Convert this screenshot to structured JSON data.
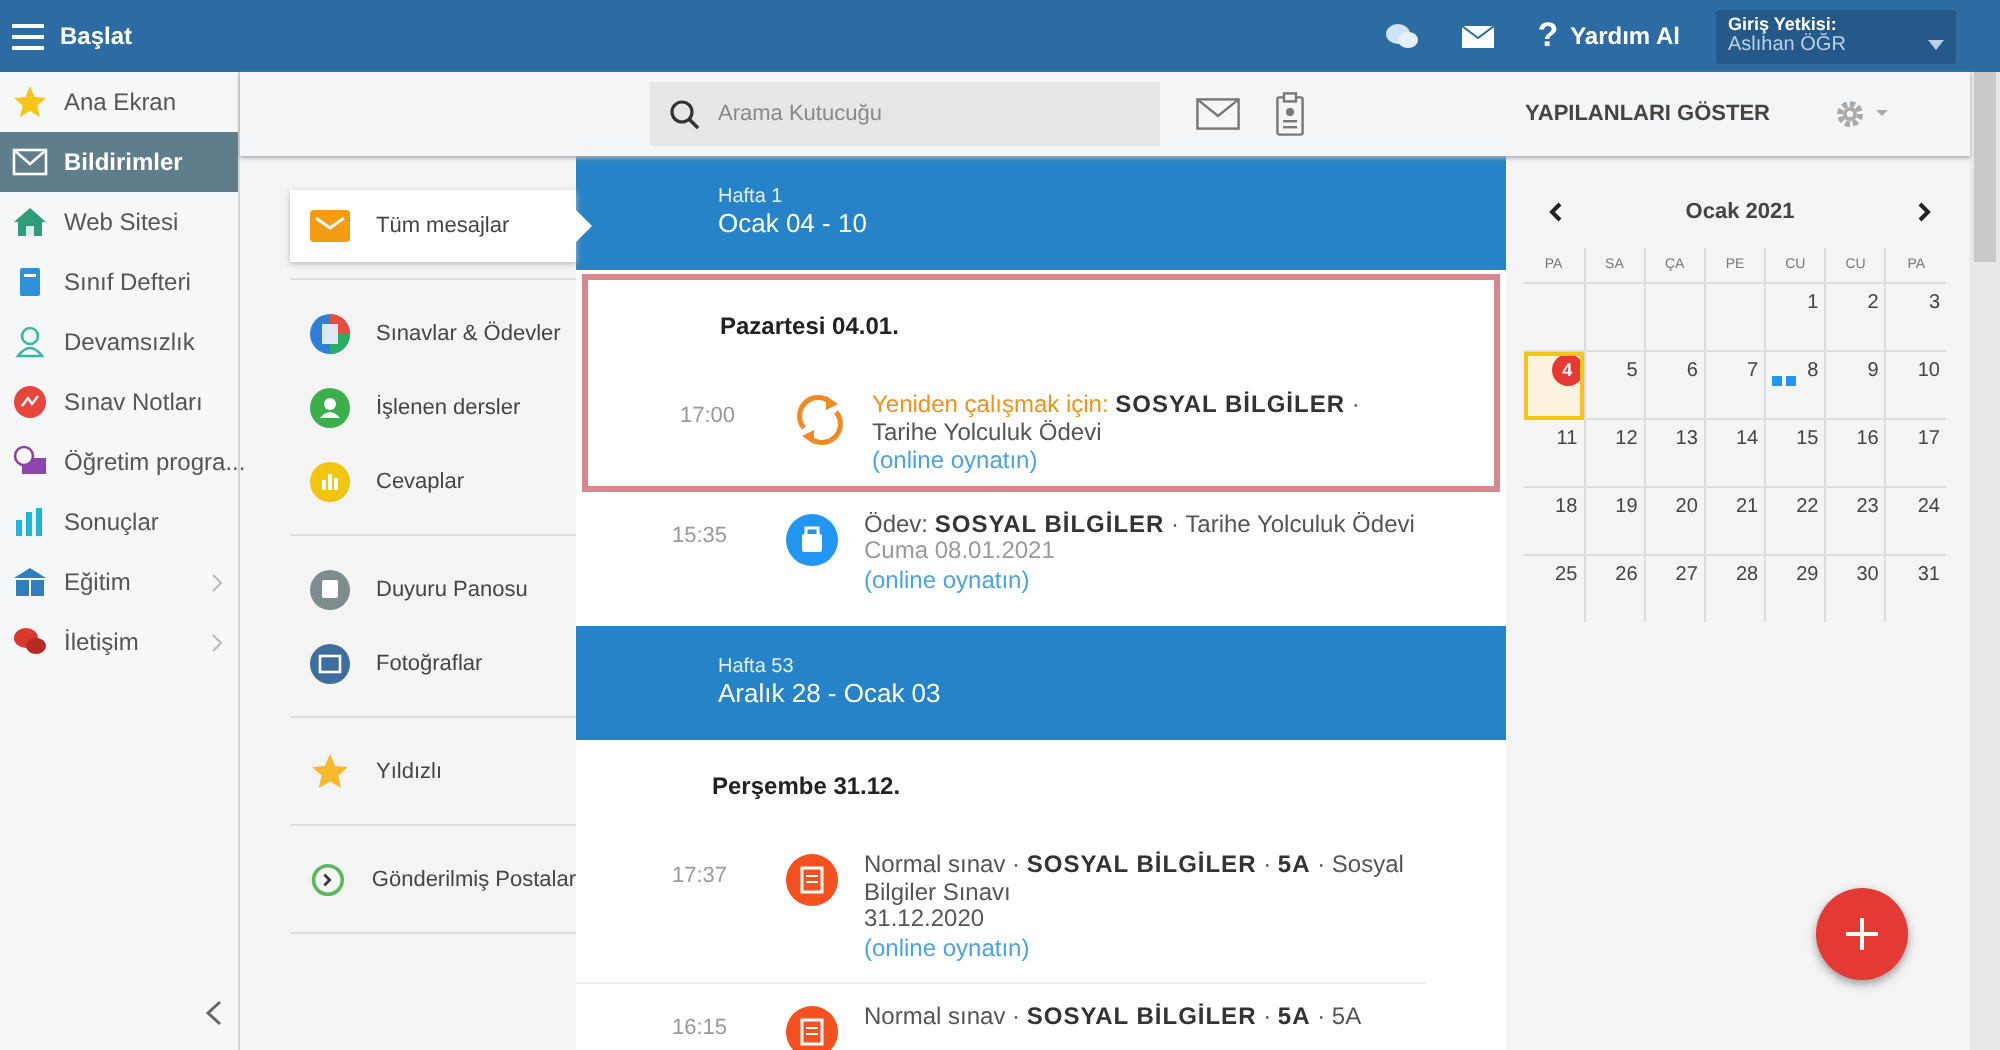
{
  "topbar": {
    "menu_label": "Başlat",
    "help_glyph": "?",
    "help_label": "Yardım Al",
    "user": {
      "label": "Giriş Yetkisi:",
      "name": "Aslıhan ÖĞR"
    }
  },
  "sidebar": {
    "items": [
      {
        "label": "Ana Ekran",
        "selected": false,
        "expandable": false
      },
      {
        "label": "Bildirimler",
        "selected": true,
        "expandable": false
      },
      {
        "label": "Web Sitesi",
        "selected": false,
        "expandable": false
      },
      {
        "label": "Sınıf Defteri",
        "selected": false,
        "expandable": false
      },
      {
        "label": "Devamsızlık",
        "selected": false,
        "expandable": false
      },
      {
        "label": "Sınav Notları",
        "selected": false,
        "expandable": false
      },
      {
        "label": "Öğretim progra...",
        "selected": false,
        "expandable": false
      },
      {
        "label": "Sonuçlar",
        "selected": false,
        "expandable": false
      },
      {
        "label": "Eğitim",
        "selected": false,
        "expandable": true
      },
      {
        "label": "İletişim",
        "selected": false,
        "expandable": true
      }
    ]
  },
  "toolbar": {
    "search_placeholder": "Arama Kutucuğu",
    "show_done": "YAPILANLARI GÖSTER"
  },
  "folders": [
    [
      {
        "label": "Tüm mesajlar",
        "selected": true
      }
    ],
    [
      {
        "label": "Sınavlar & Ödevler",
        "selected": false
      },
      {
        "label": "İşlenen dersler",
        "selected": false
      },
      {
        "label": "Cevaplar",
        "selected": false
      }
    ],
    [
      {
        "label": "Duyuru Panosu",
        "selected": false
      },
      {
        "label": "Fotoğraflar",
        "selected": false
      }
    ],
    [
      {
        "label": "Yıldızlı",
        "selected": false
      }
    ],
    [
      {
        "label": "Gönderilmiş Postalar",
        "selected": false
      }
    ]
  ],
  "feed": {
    "weeks": [
      {
        "week": "Hafta 1",
        "range": "Ocak 04 - 10",
        "days": [
          {
            "day": "Pazartesi 04.01.",
            "entries": [
              {
                "kind": "repeat",
                "highlighted": true,
                "time": "17:00",
                "label": "Yeniden çalışmak için:",
                "text": "**SOSYAL BİLGİLER** · Tarihe Yolculuk Ödevi",
                "link": "(online oynatın)"
              },
              {
                "kind": "homework",
                "highlighted": false,
                "time": "15:35",
                "label": "Ödev:",
                "text": "**SOSYAL BİLGİLER** · Tarihe Yolculuk Ödevi",
                "date": "Cuma 08.01.2021",
                "link": "(online oynatın)"
              }
            ]
          }
        ]
      },
      {
        "week": "Hafta 53",
        "range": "Aralık 28 - Ocak 03",
        "days": [
          {
            "day": "Perşembe 31.12.",
            "entries": [
              {
                "kind": "exam",
                "highlighted": false,
                "time": "17:37",
                "label": "Normal sınav ·",
                "text": "**SOSYAL BİLGİLER** · **5A** · Sosyal Bilgiler Sınavı",
                "date": "31.12.2020",
                "link": "(online oynatın)"
              },
              {
                "kind": "exam",
                "highlighted": false,
                "time": "16:15",
                "label": "Normal sınav ·",
                "text": "**SOSYAL BİLGİLER** · **5A** · 5A"
              }
            ]
          }
        ]
      }
    ]
  },
  "calendar": {
    "month": "Ocak 2021",
    "weekdays": [
      "PA",
      "SA",
      "ÇA",
      "PE",
      "CU",
      "CU",
      "PA"
    ],
    "weeks": [
      [
        {
          "d": "1",
          "selected": false,
          "today": false,
          "events": false
        },
        {
          "d": "2",
          "selected": false,
          "today": false,
          "events": false
        },
        {
          "d": "3",
          "selected": false,
          "today": false,
          "events": false
        }
      ],
      [
        {
          "d": "4",
          "selected": true,
          "today": true,
          "events": false
        },
        {
          "d": "5",
          "selected": false,
          "today": false,
          "events": false
        },
        {
          "d": "6",
          "selected": false,
          "today": false,
          "events": false
        },
        {
          "d": "7",
          "selected": false,
          "today": false,
          "events": false
        },
        {
          "d": "8",
          "selected": false,
          "today": false,
          "events": true
        },
        {
          "d": "9",
          "selected": false,
          "today": false,
          "events": false
        },
        {
          "d": "10",
          "selected": false,
          "today": false,
          "events": false
        }
      ],
      [
        {
          "d": "11",
          "selected": false,
          "today": false,
          "events": false
        },
        {
          "d": "12",
          "selected": false,
          "today": false,
          "events": false
        },
        {
          "d": "13",
          "selected": false,
          "today": false,
          "events": false
        },
        {
          "d": "14",
          "selected": false,
          "today": false,
          "events": false
        },
        {
          "d": "15",
          "selected": false,
          "today": false,
          "events": false
        },
        {
          "d": "16",
          "selected": false,
          "today": false,
          "events": false
        },
        {
          "d": "17",
          "selected": false,
          "today": false,
          "events": false
        }
      ],
      [
        {
          "d": "18",
          "selected": false,
          "today": false,
          "events": false
        },
        {
          "d": "19",
          "selected": false,
          "today": false,
          "events": false
        },
        {
          "d": "20",
          "selected": false,
          "today": false,
          "events": false
        },
        {
          "d": "21",
          "selected": false,
          "today": false,
          "events": false
        },
        {
          "d": "22",
          "selected": false,
          "today": false,
          "events": false
        },
        {
          "d": "23",
          "selected": false,
          "today": false,
          "events": false
        },
        {
          "d": "24",
          "selected": false,
          "today": false,
          "events": false
        }
      ],
      [
        {
          "d": "25",
          "selected": false,
          "today": false,
          "events": false
        },
        {
          "d": "26",
          "selected": false,
          "today": false,
          "events": false
        },
        {
          "d": "27",
          "selected": false,
          "today": false,
          "events": false
        },
        {
          "d": "28",
          "selected": false,
          "today": false,
          "events": false
        },
        {
          "d": "29",
          "selected": false,
          "today": false,
          "events": false
        },
        {
          "d": "30",
          "selected": false,
          "today": false,
          "events": false
        },
        {
          "d": "31",
          "selected": false,
          "today": false,
          "events": false
        }
      ]
    ]
  }
}
